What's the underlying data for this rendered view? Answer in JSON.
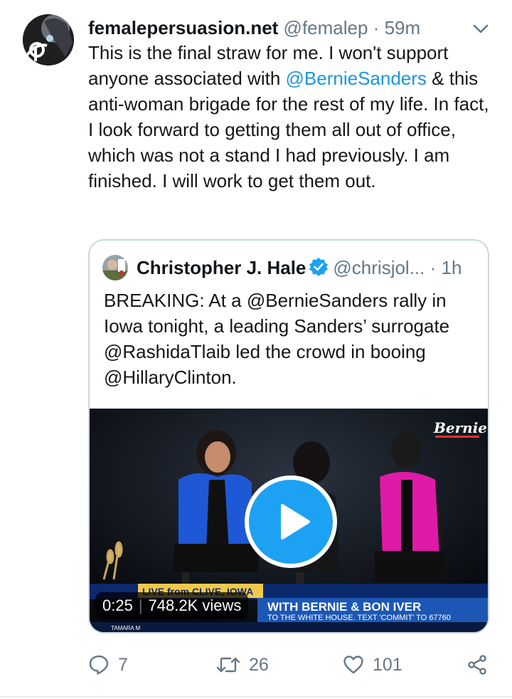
{
  "tweet": {
    "display_name": "femalepersuasion.net",
    "handle": "@femalep",
    "separator": "·",
    "time": "59m",
    "text_before_mention": "This is the final straw for me. I won't support anyone associated with ",
    "mention": "@BernieSanders",
    "text_after_mention": " & this anti-woman brigade for the rest of my life. In fact, I look forward to getting them all out of office, which was not a stand I had previously. I am finished. I will work to get them out."
  },
  "quoted_tweet": {
    "display_name": "Christopher J. Hale",
    "handle": "@chrisjol...",
    "separator": "·",
    "time": "1h",
    "text": "BREAKING: At a @BernieSanders rally in Iowa tonight, a leading Sanders’ surrogate @RashidaTlaib led the crowd in booing @HillaryClinton.",
    "media": {
      "duration": "0:25",
      "views": "748.2K views",
      "logo_text": "Bernie",
      "banner_location": "LIVE from CLIVE, IOWA",
      "banner_headline": "WITH BERNIE & BON IVER",
      "banner_ticker": "TO THE WHITE HOUSE. TEXT 'COMMIT' TO 67760",
      "banner_name": "TAMARA M"
    }
  },
  "actions": {
    "replies": "7",
    "retweets": "26",
    "likes": "101"
  },
  "colors": {
    "link": "#1b95e0",
    "muted": "#657786",
    "play": "#1da1f2",
    "border": "#ccd6dd"
  }
}
